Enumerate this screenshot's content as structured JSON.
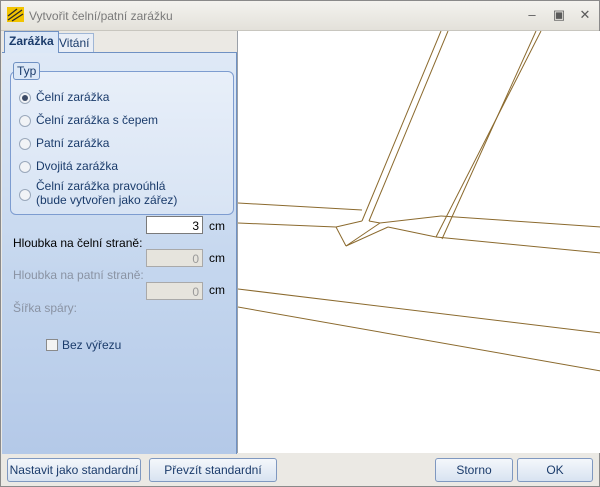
{
  "window": {
    "title": "Vytvořit čelní/patní zarážku"
  },
  "tabs": [
    {
      "label": "Zarážka",
      "active": true
    },
    {
      "label": "Vitání",
      "active": false
    }
  ],
  "group": {
    "legend": "Typ",
    "options": [
      {
        "label": "Čelní zarážka",
        "selected": true,
        "enabled": true
      },
      {
        "label": "Čelní zarážka s čepem",
        "selected": false,
        "enabled": true
      },
      {
        "label": "Patní zarážka",
        "selected": false,
        "enabled": true
      },
      {
        "label": "Dvojitá zarážka",
        "selected": false,
        "enabled": true
      },
      {
        "label_line1": "Čelní zarážka pravoúhlá",
        "label_line2": "(bude vytvořen jako zářez)",
        "selected": false,
        "enabled": true
      }
    ]
  },
  "fields": {
    "depth_front": {
      "label": "Hloubka na čelní straně:",
      "value": "3",
      "unit": "cm"
    },
    "depth_back": {
      "label": "Hloubka na patní straně:",
      "value": "0",
      "unit": "cm"
    },
    "gap_width": {
      "label": "Šířka spáry:",
      "value": "0",
      "unit": "cm"
    }
  },
  "checkbox": {
    "label": "Bez výřezu",
    "checked": false
  },
  "buttons": {
    "set_default": "Nastavit jako standardní",
    "take_default": "Převzít standardní",
    "cancel": "Storno",
    "ok": "OK"
  },
  "colors": {
    "drawing_line": "#8b6a2e",
    "accent": "#1a3b6b"
  }
}
